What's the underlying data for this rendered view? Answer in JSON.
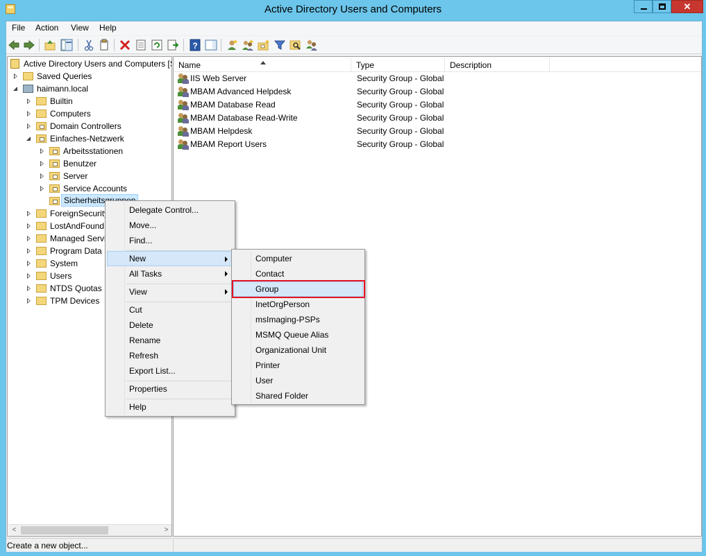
{
  "window": {
    "title": "Active Directory Users and Computers",
    "close_glyph": "✕"
  },
  "menubar": [
    "File",
    "Action",
    "View",
    "Help"
  ],
  "toolbar_icons": [
    "back-icon",
    "forward-icon",
    "up-folder-icon",
    "show-hide-tree-icon",
    "cut-icon",
    "copy-icon",
    "delete-icon",
    "properties-icon",
    "refresh-icon",
    "export-list-icon",
    "help-icon",
    "show-hide-action-pane-icon",
    "new-user-icon",
    "new-group-icon",
    "new-ou-icon",
    "filter-icon",
    "find-icon",
    "add-to-group-icon"
  ],
  "tree": {
    "root": "Active Directory Users and Computers [S",
    "saved_queries": "Saved Queries",
    "domain": "haimann.local",
    "items": {
      "builtin": "Builtin",
      "computers": "Computers",
      "domain_controllers": "Domain Controllers",
      "einfaches": "Einfaches-Netzwerk",
      "arbeitsstationen": "Arbeitsstationen",
      "benutzer": "Benutzer",
      "server": "Server",
      "service_accounts": "Service Accounts",
      "sicherheitsgruppen": "Sicherheitsgruppen",
      "foreign": "ForeignSecurity",
      "lostandfound": "LostAndFound",
      "managed": "Managed Servic",
      "program_data": "Program Data",
      "system": "System",
      "users": "Users",
      "ntds": "NTDS Quotas",
      "tpm": "TPM Devices"
    }
  },
  "list": {
    "columns": {
      "name": "Name",
      "type": "Type",
      "description": "Description"
    },
    "rows": [
      {
        "name": "IIS Web Server",
        "type": "Security Group - Global",
        "description": ""
      },
      {
        "name": "MBAM Advanced Helpdesk",
        "type": "Security Group - Global",
        "description": ""
      },
      {
        "name": "MBAM Database Read",
        "type": "Security Group - Global",
        "description": ""
      },
      {
        "name": "MBAM Database Read-Write",
        "type": "Security Group - Global",
        "description": ""
      },
      {
        "name": "MBAM Helpdesk",
        "type": "Security Group - Global",
        "description": ""
      },
      {
        "name": "MBAM Report Users",
        "type": "Security Group - Global",
        "description": ""
      }
    ]
  },
  "context_menu": {
    "delegate": "Delegate Control...",
    "move": "Move...",
    "find": "Find...",
    "new": "New",
    "all_tasks": "All Tasks",
    "view": "View",
    "cut": "Cut",
    "delete": "Delete",
    "rename": "Rename",
    "refresh": "Refresh",
    "export": "Export List...",
    "properties": "Properties",
    "help": "Help"
  },
  "new_submenu": {
    "computer": "Computer",
    "contact": "Contact",
    "group": "Group",
    "inetorgperson": "InetOrgPerson",
    "msimaging": "msImaging-PSPs",
    "msmq": "MSMQ Queue Alias",
    "ou": "Organizational Unit",
    "printer": "Printer",
    "user": "User",
    "shared_folder": "Shared Folder"
  },
  "statusbar": {
    "text": "Create a new object..."
  },
  "scrollbar": {
    "left_glyph": "<",
    "right_glyph": ">"
  },
  "colors": {
    "window_frame": "#6cc5ea",
    "highlight_box": "#e81123",
    "menu_hover": "#d5e7f8"
  }
}
